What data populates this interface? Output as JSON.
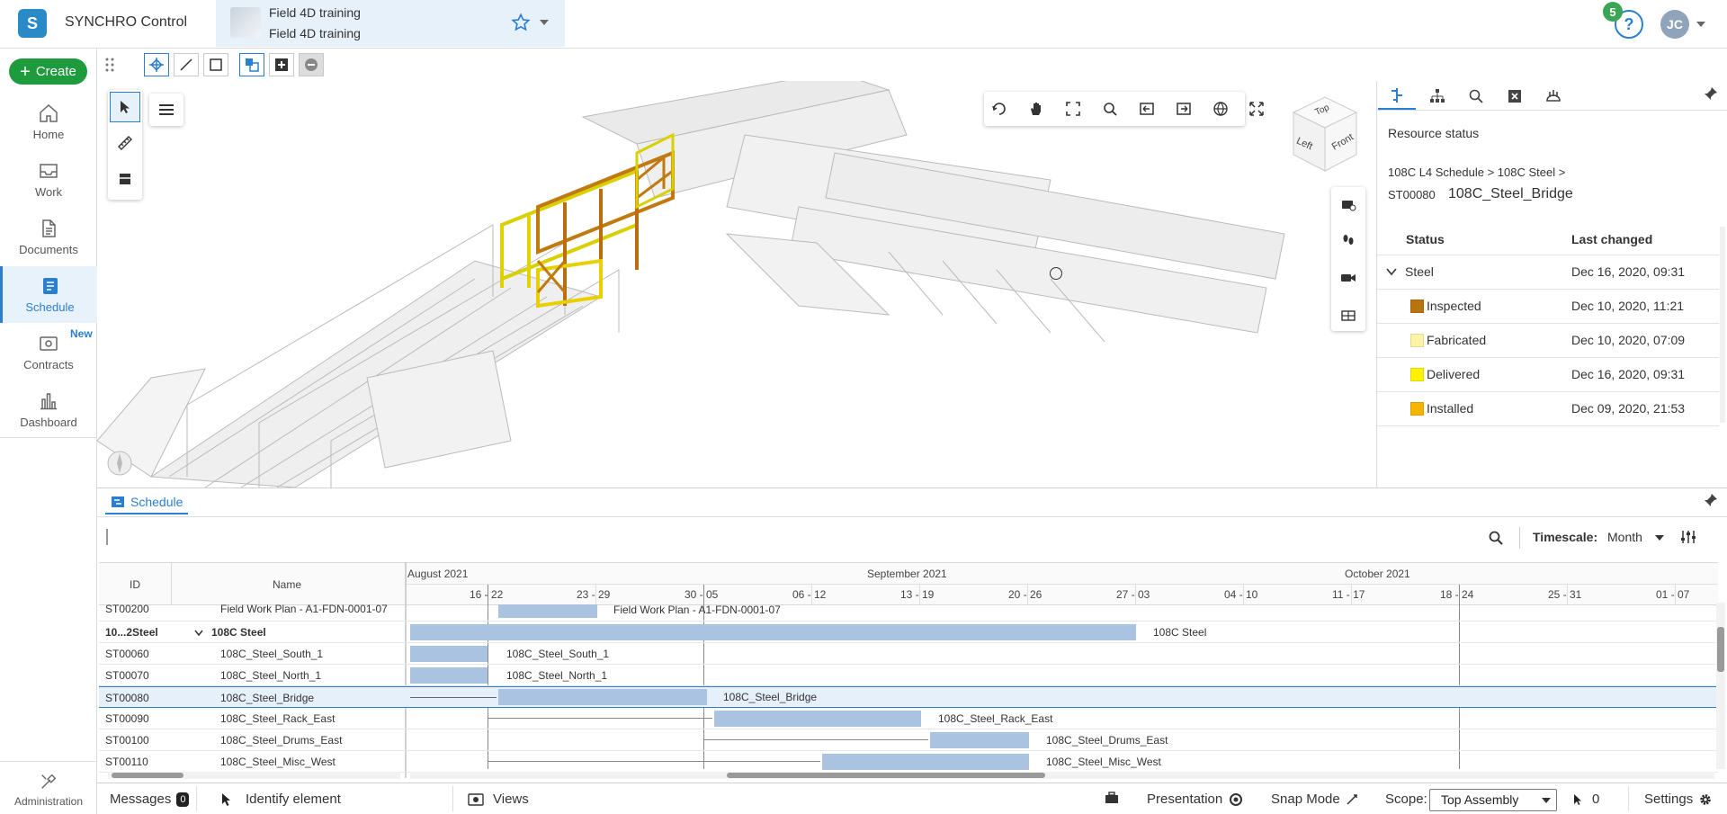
{
  "header": {
    "app_title": "SYNCHRO Control",
    "project_name": "Field 4D training",
    "project_subtitle": "Field 4D training",
    "help_badge": "5",
    "help_symbol": "?",
    "user_initials": "JC"
  },
  "nav": {
    "create_label": "Create",
    "items": [
      {
        "label": "Home",
        "icon": "home-icon"
      },
      {
        "label": "Work",
        "icon": "inbox-icon"
      },
      {
        "label": "Documents",
        "icon": "document-icon"
      },
      {
        "label": "Schedule",
        "icon": "schedule-icon",
        "active": true
      },
      {
        "label": "Contracts",
        "icon": "contracts-icon"
      },
      {
        "label": "Dashboard",
        "icon": "dashboard-icon"
      }
    ],
    "new_badge": "New",
    "admin_label": "Administration"
  },
  "resource_panel": {
    "title": "Resource status",
    "breadcrumb": "108C L4 Schedule > 108C Steel >",
    "resource_id": "ST00080",
    "resource_name": "108C_Steel_Bridge",
    "col_status": "Status",
    "col_changed": "Last changed",
    "rows": [
      {
        "label": "Steel",
        "changed": "Dec 16, 2020, 09:31",
        "group": true
      },
      {
        "label": "Inspected",
        "changed": "Dec 10, 2020, 11:21",
        "color": "#b8750f"
      },
      {
        "label": "Fabricated",
        "changed": "Dec 10, 2020, 07:09",
        "color": "#fbf4a6"
      },
      {
        "label": "Delivered",
        "changed": "Dec 16, 2020, 09:31",
        "color": "#fff200"
      },
      {
        "label": "Installed",
        "changed": "Dec 09, 2020, 21:53",
        "color": "#f5b400"
      }
    ]
  },
  "schedule": {
    "tab_label": "Schedule",
    "timescale_label": "Timescale:",
    "timescale_value": "Month",
    "col_id": "ID",
    "col_name": "Name",
    "months": [
      "August 2021",
      "September 2021",
      "October 2021"
    ],
    "weeks": [
      "16 - 22",
      "23 - 29",
      "30 - 05",
      "06 - 12",
      "13 - 19",
      "20 - 26",
      "27 - 03",
      "04 - 10",
      "11 - 17",
      "18 - 24",
      "25 - 31",
      "01 - 07"
    ],
    "rows": [
      {
        "id": "ST00200",
        "name": "Field Work Plan - A1-FDN-0001-07",
        "label": "Field Work Plan - A1-FDN-0001-07"
      },
      {
        "id": "10...2Steel",
        "name": "108C Steel",
        "label": "108C Steel",
        "summary": true
      },
      {
        "id": "ST00060",
        "name": "108C_Steel_South_1",
        "label": "108C_Steel_South_1"
      },
      {
        "id": "ST00070",
        "name": "108C_Steel_North_1",
        "label": "108C_Steel_North_1"
      },
      {
        "id": "ST00080",
        "name": "108C_Steel_Bridge",
        "label": "108C_Steel_Bridge",
        "selected": true
      },
      {
        "id": "ST00090",
        "name": "108C_Steel_Rack_East",
        "label": "108C_Steel_Rack_East"
      },
      {
        "id": "ST00100",
        "name": "108C_Steel_Drums_East",
        "label": "108C_Steel_Drums_East"
      },
      {
        "id": "ST00110",
        "name": "108C_Steel_Misc_West",
        "label": "108C_Steel_Misc_West"
      }
    ]
  },
  "statusbar": {
    "messages": "Messages",
    "messages_count": "0",
    "identify": "Identify element",
    "views": "Views",
    "presentation": "Presentation",
    "snap_mode": "Snap Mode",
    "scope_label": "Scope:",
    "scope_value": "Top Assembly",
    "cursor_count": "0",
    "settings": "Settings"
  },
  "viewcube": {
    "top": "Top",
    "left": "Left",
    "front": "Front"
  }
}
